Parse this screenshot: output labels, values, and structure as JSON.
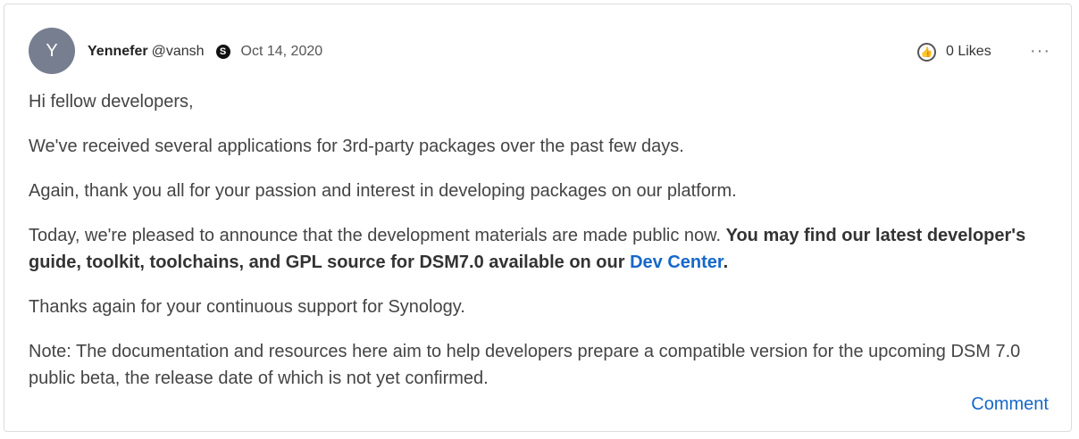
{
  "post": {
    "avatar_initial": "Y",
    "author_name": "Yennefer",
    "author_handle": "@vansh",
    "badge_letter": "S",
    "date": "Oct 14, 2020",
    "likes_label": "0 Likes",
    "more_label": "···",
    "paragraphs": {
      "p1": "Hi fellow developers,",
      "p2": "We've received several applications for 3rd-party packages over the past few days.",
      "p3": "Again, thank you all for your passion and interest in developing packages on our platform.",
      "p4_intro": "Today, we're pleased to announce that the development materials are made public now. ",
      "p4_bold": "You may find our latest developer's guide, toolkit, toolchains, and GPL source for DSM7.0 available on our ",
      "p4_link": "Dev Center",
      "p4_end": ".",
      "p5": "Thanks again for your continuous support for Synology.",
      "p6": "Note: The documentation and resources here aim to help developers prepare a compatible version for the upcoming DSM 7.0 public beta, the release date of which is not yet confirmed."
    },
    "comment_label": "Comment"
  },
  "colors": {
    "link": "#1668c8",
    "avatar_bg": "#777e8f",
    "text": "#444444"
  },
  "icons": {
    "like": "thumbs-up-icon",
    "more": "more-horizontal-icon",
    "badge": "user-badge-icon"
  }
}
